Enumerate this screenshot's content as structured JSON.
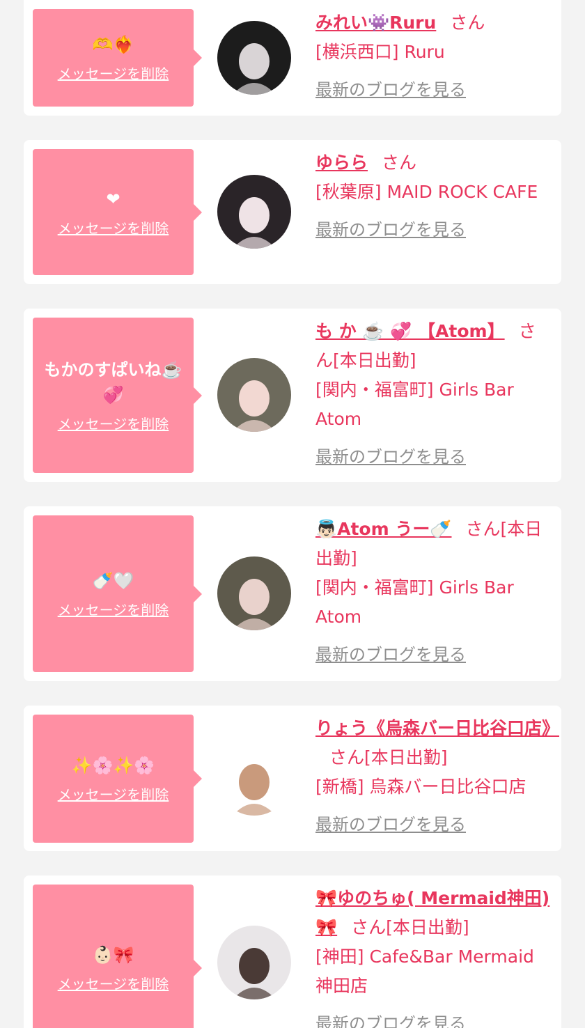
{
  "favorites": [
    {
      "message": "🫶❤️‍🔥",
      "delete_label": "メッセージを削除",
      "name": "みれい👾Ruru",
      "honorific": "さん",
      "status": "",
      "shop": "[横浜西口] Ruru",
      "blog_label": "最新のブログを見る",
      "avatar_colors": [
        "#1c1c1c",
        "#d9d4d6"
      ]
    },
    {
      "message": "❤",
      "delete_label": "メッセージを削除",
      "name": "ゆらら",
      "honorific": "さん",
      "status": "",
      "shop": "[秋葉原] MAID ROCK CAFE",
      "blog_label": "最新のブログを見る",
      "avatar_colors": [
        "#2a2428",
        "#efe3e6"
      ]
    },
    {
      "message": "もかのすぱいね☕️💞",
      "delete_label": "メッセージを削除",
      "name": "も か ☕️ 💞 【Atom】",
      "honorific": "さん",
      "status": "[本日出勤]",
      "shop": "[関内・福富町] Girls Bar Atom",
      "blog_label": "最新のブログを見る",
      "avatar_colors": [
        "#6d6a5c",
        "#f2d8d2"
      ]
    },
    {
      "message": "🍼🤍",
      "delete_label": "メッセージを削除",
      "name": "👼🏻Atom うー🍼",
      "honorific": "さん",
      "status": "[本日出勤]",
      "shop": "[関内・福富町] Girls Bar Atom",
      "blog_label": "最新のブログを見る",
      "avatar_colors": [
        "#5e5a4c",
        "#e9d2cc"
      ]
    },
    {
      "message": "✨🌸✨🌸",
      "delete_label": "メッセージを削除",
      "name": "りょう《烏森バー日比谷口店》",
      "honorific": "さん",
      "status": "[本日出勤]",
      "shop": "[新橋] 烏森バー日比谷口店",
      "blog_label": "最新のブログを見る",
      "avatar_colors": [
        "#ffffff",
        "#c99a7c"
      ]
    },
    {
      "message": "👶🏻🎀",
      "delete_label": "メッセージを削除",
      "name": "🎀ゆのちゅ( Mermaid神田)🎀",
      "honorific": "さん",
      "status": "[本日出勤]",
      "shop": "[神田] Cafe&Bar Mermaid 神田店",
      "blog_label": "最新のブログを見る",
      "avatar_colors": [
        "#e9e6e8",
        "#4a3a36"
      ]
    }
  ]
}
